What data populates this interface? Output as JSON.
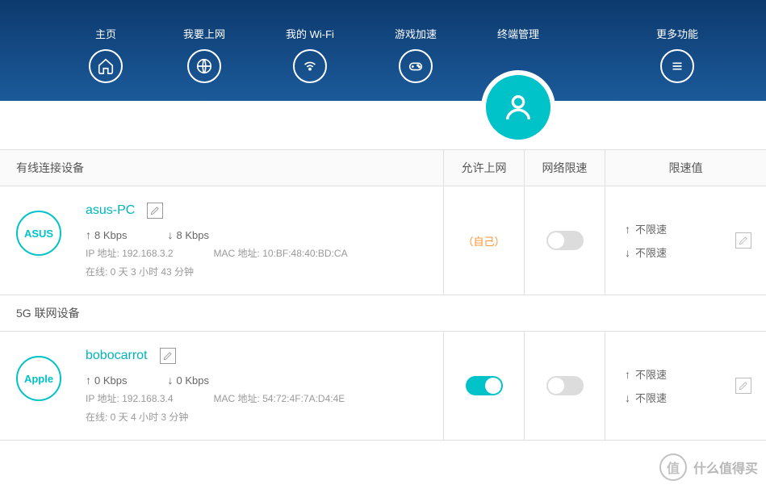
{
  "nav": {
    "home": "主页",
    "internet": "我要上网",
    "wifi": "我的 Wi-Fi",
    "game": "游戏加速",
    "terminal": "终端管理",
    "more": "更多功能"
  },
  "columns": {
    "wired": "有线连接设备",
    "allow": "允许上网",
    "limit": "网络限速",
    "limitval": "限速值"
  },
  "section2": "5G 联网设备",
  "labels": {
    "ip_prefix": "IP 地址: ",
    "mac_prefix": "MAC 地址: ",
    "online_prefix": "在线:  ",
    "self": "（自己）"
  },
  "devices": [
    {
      "badge": "ASUS",
      "name": "asus-PC",
      "up": "8 Kbps",
      "down": "8 Kbps",
      "ip": "192.168.3.2",
      "mac": "10:BF:48:40:BD:CA",
      "online": "0 天 3 小时 43 分钟",
      "self": true,
      "allow_on": false,
      "limit_on": false,
      "limit_up": "不限速",
      "limit_down": "不限速"
    },
    {
      "badge": "Apple",
      "name": "bobocarrot",
      "up": "0 Kbps",
      "down": "0 Kbps",
      "ip": "192.168.3.4",
      "mac": "54:72:4F:7A:D4:4E",
      "online": "0 天 4 小时 3 分钟",
      "self": false,
      "allow_on": true,
      "limit_on": false,
      "limit_up": "不限速",
      "limit_down": "不限速"
    }
  ],
  "watermark": {
    "icon": "值",
    "text": "什么值得买"
  }
}
